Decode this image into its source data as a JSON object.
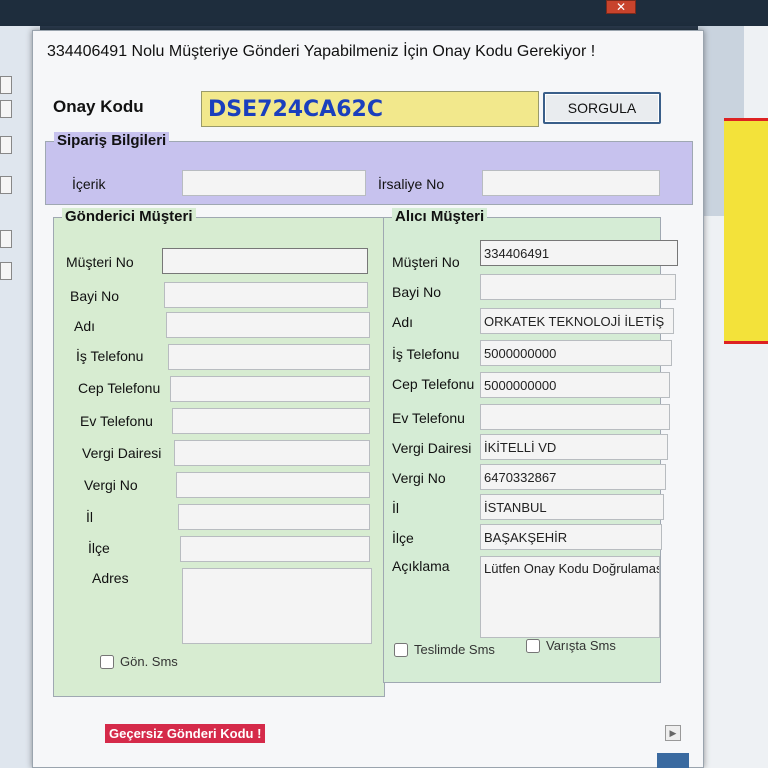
{
  "dialog": {
    "title": "334406491 Nolu Müşteriye Gönderi Yapabilmeniz İçin Onay Kodu Gerekiyor !",
    "onay_label": "Onay Kodu",
    "onay_value": "DSE724CA62C",
    "sorgula_label": "SORGULA"
  },
  "siparis": {
    "legend": "Sipariş Bilgileri",
    "icerik_label": "İçerik",
    "icerik_value": "",
    "irsaliye_label": "İrsaliye No",
    "irsaliye_value": ""
  },
  "gonderici": {
    "legend": "Gönderici Müşteri",
    "fields": [
      {
        "label": "Müşteri No",
        "value": ""
      },
      {
        "label": "Bayi No",
        "value": ""
      },
      {
        "label": "Adı",
        "value": ""
      },
      {
        "label": "İş Telefonu",
        "value": ""
      },
      {
        "label": "Cep Telefonu",
        "value": ""
      },
      {
        "label": "Ev Telefonu",
        "value": ""
      },
      {
        "label": "Vergi Dairesi",
        "value": ""
      },
      {
        "label": "Vergi No",
        "value": ""
      },
      {
        "label": "İl",
        "value": ""
      },
      {
        "label": "İlçe",
        "value": ""
      }
    ],
    "adres_label": "Adres",
    "adres_value": "",
    "sms_label": "Gön. Sms"
  },
  "alici": {
    "legend": "Alıcı Müşteri",
    "fields": [
      {
        "label": "Müşteri No",
        "value": "334406491"
      },
      {
        "label": "Bayi No",
        "value": ""
      },
      {
        "label": "Adı",
        "value": "ORKATEK TEKNOLOJİ İLETİŞ"
      },
      {
        "label": "İş Telefonu",
        "value": "5000000000"
      },
      {
        "label": "Cep Telefonu",
        "value": "5000000000"
      },
      {
        "label": "Ev Telefonu",
        "value": ""
      },
      {
        "label": "Vergi Dairesi",
        "value": "İKİTELLİ VD"
      },
      {
        "label": "Vergi No",
        "value": "6470332867"
      },
      {
        "label": "İl",
        "value": "İSTANBUL"
      },
      {
        "label": "İlçe",
        "value": "BAŞAKŞEHİR"
      }
    ],
    "aciklama_label": "Açıklama",
    "aciklama_value": "Lütfen Onay Kodu Doğrulaması yapınız !",
    "teslimde_label": "Teslimde Sms",
    "varista_label": "Varışta Sms"
  },
  "status": {
    "error_text": "Geçersiz Gönderi Kodu !"
  },
  "colors": {
    "purple_panel": "#c7c2ee",
    "green_panel": "#d7ecd1",
    "code_highlight": "#f2e88c",
    "code_text": "#1a3fbd",
    "error_bg": "#d52a4a"
  }
}
